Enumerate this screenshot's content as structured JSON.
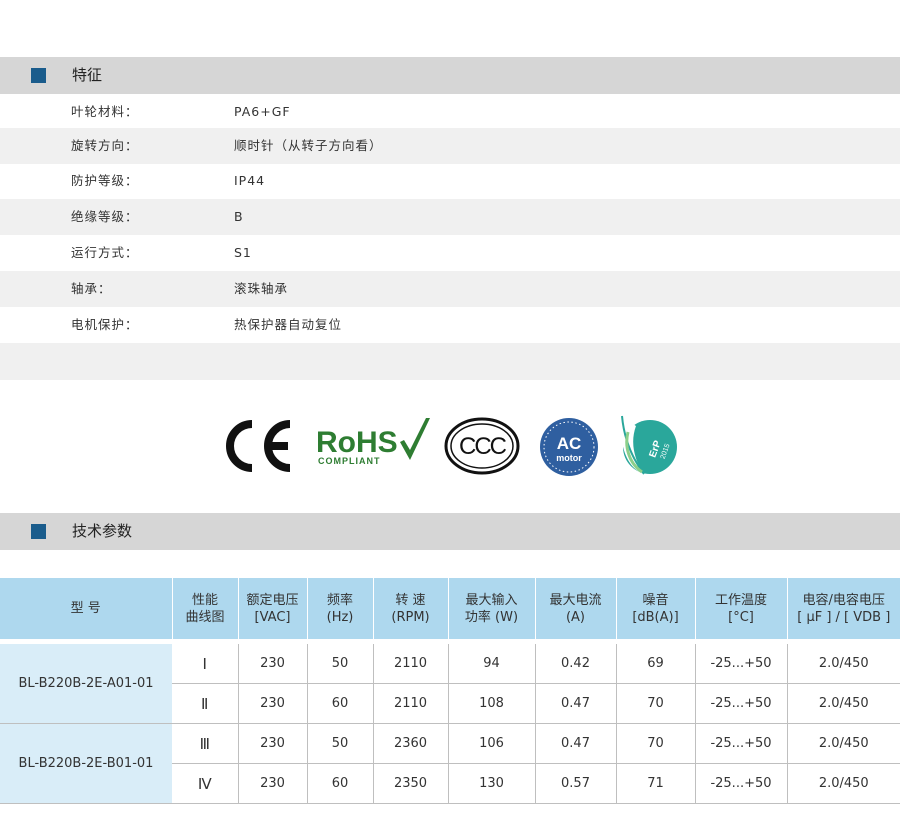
{
  "features_section": {
    "title": "特征"
  },
  "features": [
    {
      "label": "叶轮材料：",
      "value": "PA6+GF"
    },
    {
      "label": "旋转方向：",
      "value": "顺时针（从转子方向看）"
    },
    {
      "label": "防护等级：",
      "value": "IP44"
    },
    {
      "label": "绝缘等级：",
      "value": "B"
    },
    {
      "label": "运行方式：",
      "value": "S1"
    },
    {
      "label": "轴承：",
      "value": "滚珠轴承"
    },
    {
      "label": "电机保护：",
      "value": "热保护器自动复位"
    }
  ],
  "certifications": {
    "ce": "CE",
    "rohs": {
      "name": "RoHS",
      "sub": "COMPLIANT"
    },
    "ccc": "CCC",
    "ac_motor": {
      "top": "AC",
      "bottom": "motor"
    },
    "erp": {
      "name": "ErP",
      "year": "2015"
    }
  },
  "tech_section": {
    "title": "技术参数"
  },
  "table": {
    "headers": [
      {
        "line1": "型 号",
        "line2": ""
      },
      {
        "line1": "性能",
        "line2": "曲线图"
      },
      {
        "line1": "额定电压",
        "line2": "[VAC]"
      },
      {
        "line1": "频率",
        "line2": "(Hz)"
      },
      {
        "line1": "转 速",
        "line2": "(RPM)"
      },
      {
        "line1": "最大输入",
        "line2": "功率 (W)"
      },
      {
        "line1": "最大电流",
        "line2": "(A)"
      },
      {
        "line1": "噪音",
        "line2": "[dB(A)]"
      },
      {
        "line1": "工作温度",
        "line2": "[°C]"
      },
      {
        "line1": "电容/电容电压",
        "line2": "[ μF ] / [ VDB ]"
      }
    ],
    "models": [
      {
        "name": "BL-B220B-2E-A01-01",
        "rows": [
          {
            "curve": "Ⅰ",
            "voltage": "230",
            "freq": "50",
            "rpm": "2110",
            "power": "94",
            "current": "0.42",
            "noise": "69",
            "temp": "-25...+50",
            "cap": "2.0/450"
          },
          {
            "curve": "Ⅱ",
            "voltage": "230",
            "freq": "60",
            "rpm": "2110",
            "power": "108",
            "current": "0.47",
            "noise": "70",
            "temp": "-25...+50",
            "cap": "2.0/450"
          }
        ]
      },
      {
        "name": "BL-B220B-2E-B01-01",
        "rows": [
          {
            "curve": "Ⅲ",
            "voltage": "230",
            "freq": "50",
            "rpm": "2360",
            "power": "106",
            "current": "0.47",
            "noise": "70",
            "temp": "-25...+50",
            "cap": "2.0/450"
          },
          {
            "curve": "Ⅳ",
            "voltage": "230",
            "freq": "60",
            "rpm": "2350",
            "power": "130",
            "current": "0.57",
            "noise": "71",
            "temp": "-25...+50",
            "cap": "2.0/450"
          }
        ]
      }
    ]
  },
  "colors": {
    "section_bar": "#d6d6d6",
    "section_square": "#1a5c8c",
    "table_header": "#aed8ee",
    "model_cell": "#d9edf8",
    "rohs_green": "#2e7d32",
    "ac_blue": "#2f5fa0",
    "erp_teal": "#2aa79b"
  }
}
